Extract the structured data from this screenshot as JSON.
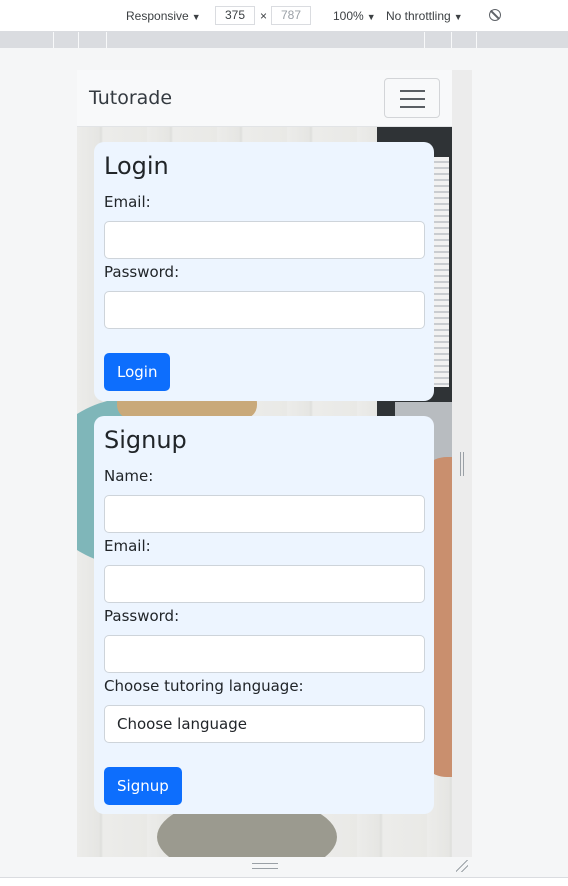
{
  "devtools": {
    "device": "Responsive",
    "width": "375",
    "height_placeholder": "787",
    "times": "×",
    "zoom": "100%",
    "throttling": "No throttling"
  },
  "navbar": {
    "brand": "Tutorade"
  },
  "login": {
    "title": "Login",
    "email_label": "Email:",
    "password_label": "Password:",
    "submit_label": "Login"
  },
  "signup": {
    "title": "Signup",
    "name_label": "Name:",
    "email_label": "Email:",
    "password_label": "Password:",
    "language_label": "Choose tutoring language:",
    "language_selected": "Choose language",
    "submit_label": "Signup"
  },
  "colors": {
    "primary": "#0d6efd",
    "card_bg": "#edf5ff",
    "navbar_bg": "#f8f9fa"
  }
}
